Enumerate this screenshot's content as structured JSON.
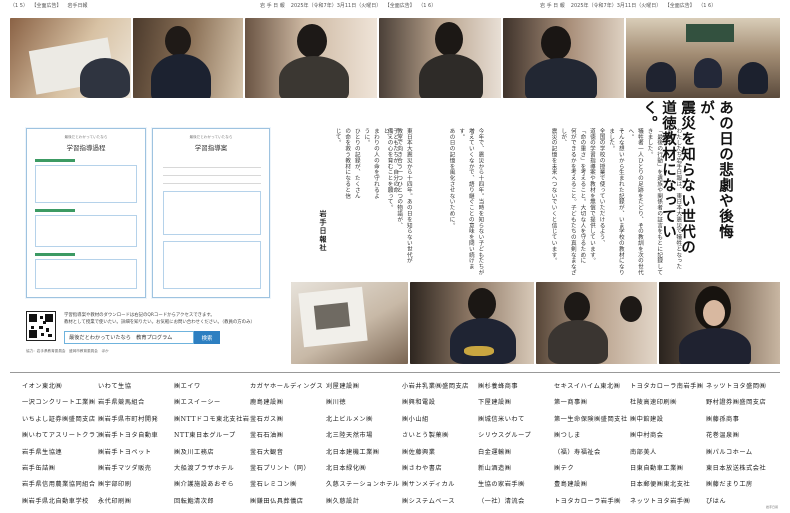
{
  "header": {
    "left": [
      "（1 5）",
      "【全面広告】",
      "岩手日報"
    ],
    "center": [
      "岩 手 日 報",
      "2025年（令和7年）3月11日（火曜日）",
      "【全面広告】",
      "（1 6）"
    ],
    "right": [
      "岩 手 日 報",
      "2025年（令和7年）3月11日（火曜日）",
      "【全面広告】",
      "（1 6）"
    ]
  },
  "headline": [
    "あの日の悲劇や後悔が、",
    "震災を知らない世代の",
    "道徳教材になっていく。"
  ],
  "body_columns": [
    "わたしたち岩手日報は、東日本大震災で犠牲となった方々の",
    "「最後の行動」を遺族や関係者の証言をもとに記録してきました。",
    "犠牲者一人ひとりの足跡をたどり、その教訓を次の世代へ。",
    "そんな想いから生まれた記録が、いま学校の教材になりました。",
    "全国の学校の授業で使っていただけるよう、",
    "道徳の学習指導案や教材を無償で提供しています。",
    "「命の重さ」を考えること。大切な人を守るために",
    "何ができるかを考えること。子どもたちの真剣なまなざしが、",
    "震災の記憶を未来へつないでいくと信じています。",
    "今年で、震災から十四年。当時を知らない子どもたちが",
    "増えていくなかで、語り継ぐことの意味を問い続けます。",
    "あの日の記憶を風化させないために。",
    "東日本大震災から十四年。あの日を知らない世代が",
    "教室で向き合う一つひとつの物語が、",
    "備えの心を育むことを願って。",
    "子どもたちが、自分の命と、",
    "まわりの人の命を守れるように。",
    "ひとりの記録が、たくさんの命を救う教材になると信じて。"
  ],
  "signature": "岩手日報社",
  "doc_left": {
    "pretitle": "最後だとわかっていたなら",
    "title": "学習指導過程"
  },
  "doc_right": {
    "pretitle": "最後だとわかっていたなら",
    "title": "学習指導案"
  },
  "intro": [
    "学習指導案や教材のダウンロードは右記のQRコードからアクセスできます。",
    "教材として授業で使いたい。詳細を知りたい。お気軽にお問い合わせください。（教員の方のみ）"
  ],
  "search": {
    "value": "最後だとわかっていたなら　教育プログラム",
    "button": "検索"
  },
  "footnote": "協力：岩手県教育委員会　盛岡市教育委員会　ほか",
  "sponsors": [
    "イオン東北㈱",
    "一沢コンクリート工業㈱",
    "いちよし証券㈱盛岡支店",
    "㈱いわてアスリートクラブ",
    "岩手県生協連",
    "岩手缶詰㈱",
    "岩手県信用農業協同組合",
    "㈱岩手県北自動車学校",
    "いわて生協",
    "岩手県競馬組合",
    "㈱岩手県市町村開発",
    "㈱岩手トヨタ自動車",
    "㈱岩手トヨペット",
    "㈱岩手マツダ販売",
    "㈱宇部印刷",
    "永代印刷㈱",
    "㈱エイワ",
    "㈱エスイーシー",
    "㈱NTTドコモ東北支社岩手支店",
    "NTT東日本グループ",
    "㈱及川工務店",
    "大船渡プラザホテル",
    "㈱介護施設あおぞら",
    "回転鮨清次郎",
    "カガヤホールディングス",
    "鹿島建設㈱",
    "釜石ガス㈱",
    "釜石石油㈱",
    "釜石大観音",
    "釜石プリント（同）",
    "釜石レミコン㈱",
    "㈱鎌田仏具葬儀店",
    "刈屋建設㈱",
    "㈱川徳",
    "北上ビルメン㈱",
    "北三陸天然市場",
    "北日本建機工業㈱",
    "北日本緑化㈱",
    "久慈ステーションホテル",
    "㈱久慈設計",
    "小岩井乳業㈱盛岡支店",
    "㈱興和電設",
    "㈱小山組",
    "さいとう製菓㈱",
    "㈱佐藤興業",
    "㈱さわや書店",
    "㈱サンメディカル",
    "㈱システムベース",
    "㈱杉養蜂商事",
    "下屋建設㈱",
    "㈱城信米いわて",
    "シリウスグループ",
    "白金運輸㈱",
    "新山酒造㈱",
    "生協の家岩手㈱",
    "（一社）清流会",
    "セキスイハイム東北㈱",
    "第一商事㈱",
    "第一生命保険㈱盛岡支社",
    "㈱つしま",
    "（福）寿福祉会",
    "㈱テク",
    "豊島建設㈱",
    "トヨタカローラ岩手㈱",
    "トヨタカローラ南岩手㈱",
    "杜陵高速印刷㈱",
    "㈱中館建設",
    "㈱中村商会",
    "南部美人",
    "日東自動車工業㈱",
    "日本郵便㈱東北支社",
    "ネッツトヨタ岩手㈱",
    "ネッツトヨタ盛岡㈱",
    "野村證券㈱盛岡支店",
    "㈱藤孫商事",
    "花巻温泉㈱",
    "㈱パルコホーム",
    "東日本放送株式会社",
    "㈱藤だまり工房",
    "ぴはん"
  ],
  "sponsor_mark": "岩手日報"
}
